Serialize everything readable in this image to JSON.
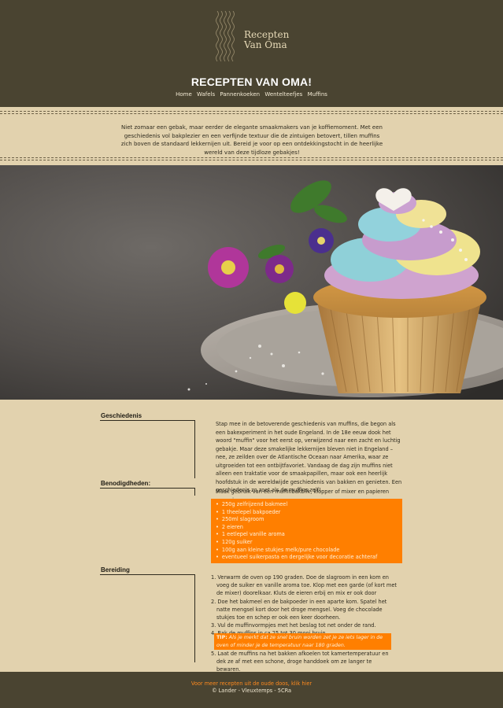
{
  "header": {
    "logo_line1": "Recepten",
    "logo_line2": "Van Oma",
    "site_title": "RECEPTEN VAN OMA!",
    "nav": [
      "Home",
      "Wafels",
      "Pannenkoeken",
      "Wentelteefjes",
      "Muffins"
    ]
  },
  "intro": {
    "text": "Niet zomaar een gebak, maar eerder de elegante smaakmakers van je koffiemoment. Met een geschiedenis vol bakplezier en een verfijnde textuur die de zintuigen betovert, tillen muffins zich boven de standaard lekkernijen uit. Bereid je voor op een ontdekkingstocht in de heerlijke wereld van deze tijdloze gebakjes!"
  },
  "sections": {
    "history_label": "Geschiedenis",
    "history_text": "Stap mee in de betoverende geschiedenis van muffins, die begon als een bakexperiment in het oude Engeland. In de 18e eeuw dook het woord \"muffin\" voor het eerst op, verwijzend naar een zacht en luchtig gebakje. Maar deze smakelijke lekkernijen bleven niet in Engeland – nee, ze zeilden over de Atlantische Oceaan naar Amerika, waar ze uitgroeiden tot een ontbijtfavoriet. Vandaag de dag zijn muffins niet alleen een traktatie voor de smaakpapillen, maar ook een heerlijk hoofdstuk in de wereldwijde geschiedenis van bakken en genieten. Een geschiedenis zo zoet als de muffins zelf!",
    "needs_label": "Benodigdheden:",
    "needs_text": "Maak gebruik van een muffinbakblik, klopper of mixer en papieren vormpjes.",
    "ingredients": [
      "250g zelfrijzend bakmeel",
      "1 theelepel bakpoeder",
      "250ml slagroom",
      "2 eieren",
      "1 eetlepel vanille aroma",
      "120g suiker",
      "100g aan kleine stukjes melk/pure chocolade",
      "eventueel suikerpasta en dergelijke voor decoratie achteraf"
    ],
    "prep_label": "Bereiding",
    "steps": [
      "1. Verwarm de oven op 190 graden. Doe de slagroom in een kom en voeg de suiker en vanille aroma toe. Klop met een garde (of kort met de mixer) doorelkaar. Kluts de eieren erbij en mix er ook door",
      "2. Doe het bakmeel en de bakpoeder in een aparte kom. Spatel het natte mengsel kort door het droge mengsel. Voeg de chocolade stukjes toe en schep er ook een keer doorheen.",
      "3. Vul de muffinvormpjes met het beslag tot net onder de rand.",
      "4. Bak de muffins in ca 25 tot 30 mooi bruin."
    ],
    "tip_label": "TIP:",
    "tip_text": "Als je merkt dat ze snel bruin worden zet je ze iets lager in de oven of minder je de temperatuur naar 180 graden.",
    "step5": "5. Laat de muffins na het bakken afkoelen tot kamertemperatuur en dek ze af met een schone, droge handdoek om ze langer te bewaren."
  },
  "footer": {
    "more_link": "Voor meer recepten uit de oude doos, klik hier",
    "copyright": "© Lander - Vleuxtemps - 5CRa"
  },
  "colors": {
    "header_bg": "#4a4431",
    "page_bg": "#e2d2ae",
    "accent_orange": "#ff7f00"
  }
}
